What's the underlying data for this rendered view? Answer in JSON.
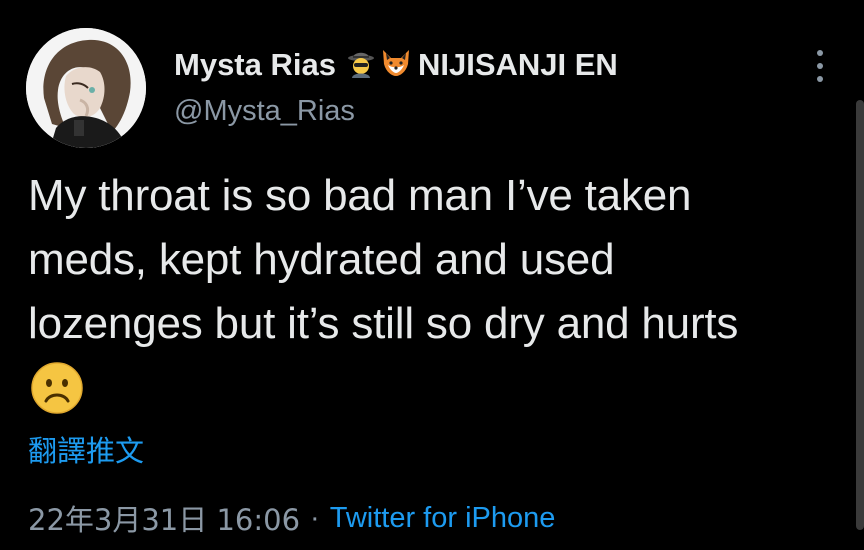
{
  "author": {
    "display_name": "Mysta Rias",
    "affiliation": "NIJISANJI EN",
    "handle": "@Mysta_Rias",
    "badge_icons": [
      "spy-emoji-icon",
      "fox-emoji-icon"
    ],
    "avatar": "avatar-illustration"
  },
  "tweet": {
    "lines": [
      "My throat is so bad man I’ve taken",
      "meds, kept hydrated and used",
      "lozenges but it’s still so dry and hurts"
    ],
    "trailing_emoji": "frowning-face-icon"
  },
  "actions": {
    "translate_label": "翻譯推文",
    "more_icon": "more-options-icon"
  },
  "meta": {
    "datetime": "22年3月31日 16:06",
    "separator": "·",
    "source": "Twitter for iPhone"
  },
  "colors": {
    "background": "#000000",
    "text": "#e7e9ea",
    "secondary": "#8b98a5",
    "link": "#1d9bf0"
  }
}
